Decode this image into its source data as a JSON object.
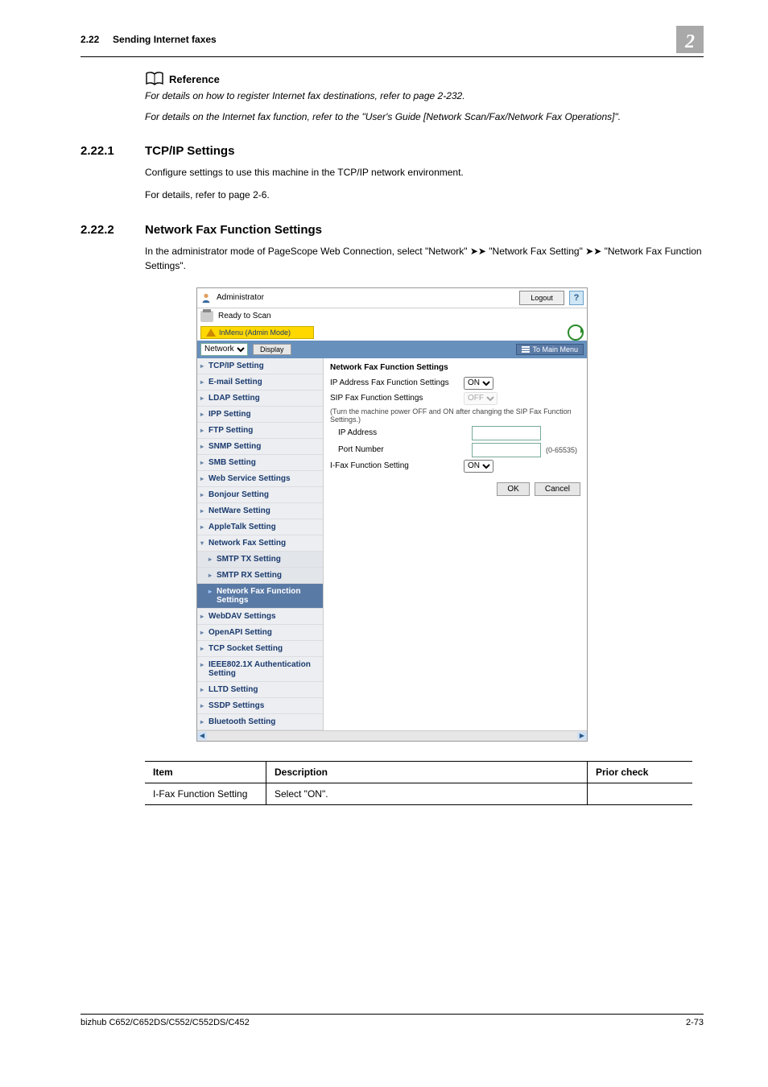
{
  "header": {
    "section_no": "2.22",
    "section_title": "Sending Internet faxes",
    "chapter_no": "2"
  },
  "reference": {
    "label": "Reference",
    "line1": "For details on how to register Internet fax destinations, refer to page 2-232.",
    "line2": "For details on the Internet fax function, refer to the \"User's Guide [Network Scan/Fax/Network Fax Operations]\"."
  },
  "s1": {
    "num": "2.22.1",
    "title": "TCP/IP Settings",
    "p1": "Configure settings to use this machine in the TCP/IP network environment.",
    "p2": "For details, refer to page 2-6."
  },
  "s2": {
    "num": "2.22.2",
    "title": "Network Fax Function Settings",
    "p1": "In the administrator mode of PageScope Web Connection, select \"Network\" ➤➤ \"Network Fax Setting\" ➤➤ \"Network Fax Function Settings\"."
  },
  "shot": {
    "admin_label": "Administrator",
    "logout": "Logout",
    "help": "?",
    "ready": "Ready to Scan",
    "mode_tab": "InMenu (Admin Mode)",
    "dropdown": "Network",
    "display_btn": "Display",
    "to_main": "To Main Menu",
    "sidebar": [
      "TCP/IP Setting",
      "E-mail Setting",
      "LDAP Setting",
      "IPP Setting",
      "FTP Setting",
      "SNMP Setting",
      "SMB Setting",
      "Web Service Settings",
      "Bonjour Setting",
      "NetWare Setting",
      "AppleTalk Setting"
    ],
    "sidebar_open": "Network Fax Setting",
    "sidebar_sub": [
      "SMTP TX Setting",
      "SMTP RX Setting",
      "Network Fax Function Settings"
    ],
    "sidebar_after": [
      "WebDAV Settings",
      "OpenAPI Setting",
      "TCP Socket Setting",
      "IEEE802.1X Authentication Setting",
      "LLTD Setting",
      "SSDP Settings",
      "Bluetooth Setting"
    ],
    "pane": {
      "title": "Network Fax Function Settings",
      "r1_label": "IP Address Fax Function Settings",
      "r1_value": "ON",
      "r2_label": "SIP Fax Function Settings",
      "r2_value": "OFF",
      "hint": "(Turn the machine power OFF and ON after changing the SIP Fax Function Settings.)",
      "r3_label": "IP Address",
      "r3_value": "",
      "r4_label": "Port Number",
      "r4_value": "",
      "r4_range": "(0-65535)",
      "r5_label": "I-Fax Function Setting",
      "r5_value": "ON",
      "ok": "OK",
      "cancel": "Cancel"
    }
  },
  "table": {
    "h1": "Item",
    "h2": "Description",
    "h3": "Prior check",
    "c1": "I-Fax Function Setting",
    "c2": "Select \"ON\".",
    "c3": ""
  },
  "footer": {
    "model": "bizhub C652/C652DS/C552/C552DS/C452",
    "page": "2-73"
  }
}
